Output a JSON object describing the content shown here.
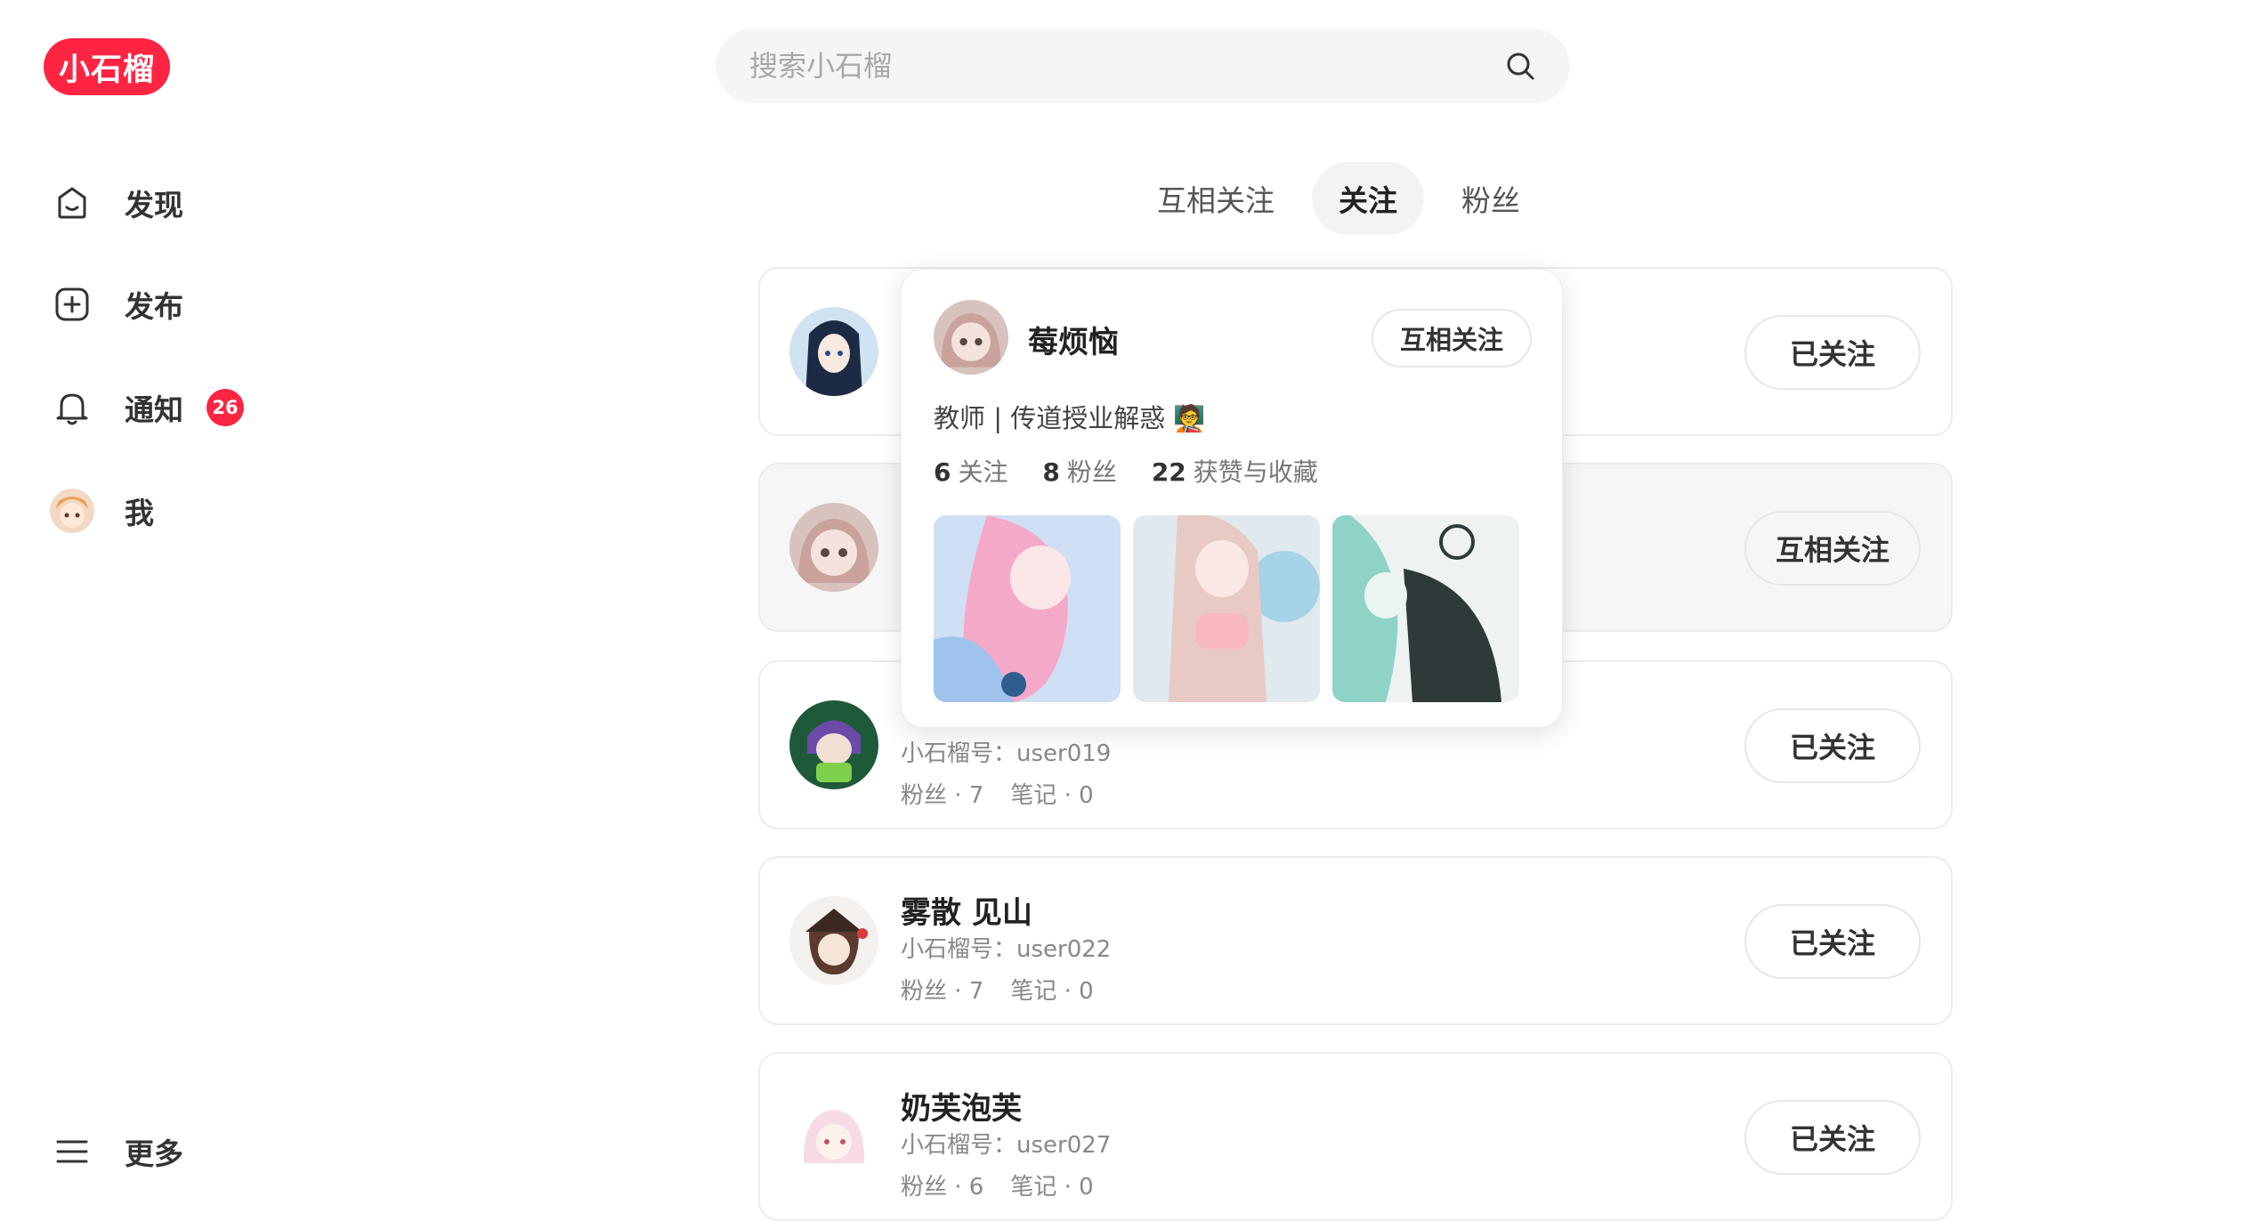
{
  "brand": {
    "logo_text": "小石榴",
    "accent": "#ff2442"
  },
  "search": {
    "placeholder": "搜索小石榴"
  },
  "sidebar": {
    "items": [
      {
        "label": "发现",
        "icon": "home-icon"
      },
      {
        "label": "发布",
        "icon": "plus-square-icon"
      },
      {
        "label": "通知",
        "icon": "bell-icon",
        "badge": "26"
      },
      {
        "label": "我",
        "icon": "avatar"
      }
    ],
    "more_label": "更多"
  },
  "tabs": [
    {
      "label": "互相关注",
      "active": false
    },
    {
      "label": "关注",
      "active": true
    },
    {
      "label": "粉丝",
      "active": false
    }
  ],
  "users": [
    {
      "name": "",
      "uid": "",
      "fans": "",
      "notes": "",
      "button": "已关注"
    },
    {
      "name": "",
      "uid": "",
      "fans": "",
      "notes": "",
      "button": "互相关注"
    },
    {
      "name": "",
      "uid": "小石榴号：user019",
      "fans": "粉丝 · 7",
      "notes": "笔记 · 0",
      "button": "已关注"
    },
    {
      "name": "雾散 见山",
      "uid": "小石榴号：user022",
      "fans": "粉丝 · 7",
      "notes": "笔记 · 0",
      "button": "已关注"
    },
    {
      "name": "奶芙泡芙",
      "uid": "小石榴号：user027",
      "fans": "粉丝 · 6",
      "notes": "笔记 · 0",
      "button": "已关注"
    }
  ],
  "popover": {
    "name": "莓烦恼",
    "button": "互相关注",
    "bio": "教师 | 传道授业解惑 🧑‍🏫",
    "following_count": "6",
    "following_label": "关注",
    "fans_count": "8",
    "fans_label": "粉丝",
    "likes_count": "22",
    "likes_label": "获赞与收藏"
  }
}
